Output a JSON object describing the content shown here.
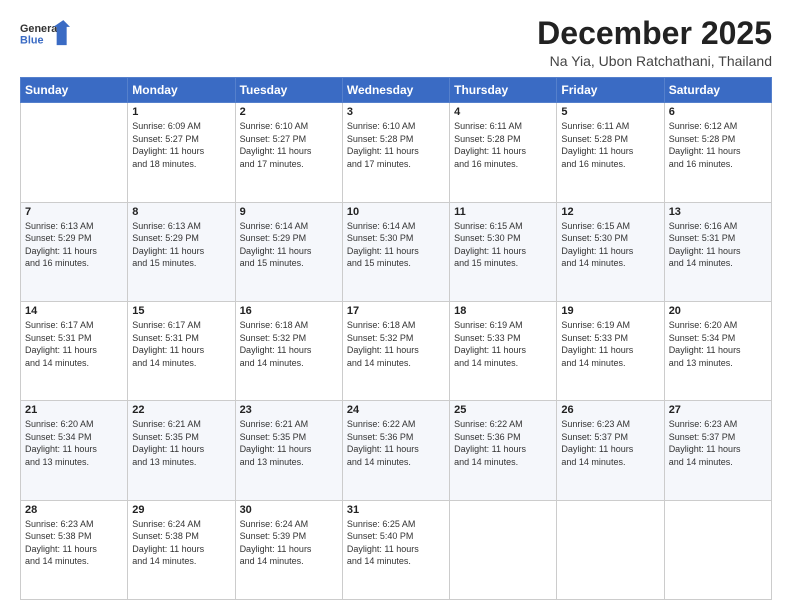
{
  "logo": {
    "line1": "General",
    "line2": "Blue"
  },
  "title": "December 2025",
  "location": "Na Yia, Ubon Ratchathani, Thailand",
  "days_of_week": [
    "Sunday",
    "Monday",
    "Tuesday",
    "Wednesday",
    "Thursday",
    "Friday",
    "Saturday"
  ],
  "weeks": [
    [
      {
        "day": "",
        "info": ""
      },
      {
        "day": "1",
        "info": "Sunrise: 6:09 AM\nSunset: 5:27 PM\nDaylight: 11 hours\nand 18 minutes."
      },
      {
        "day": "2",
        "info": "Sunrise: 6:10 AM\nSunset: 5:27 PM\nDaylight: 11 hours\nand 17 minutes."
      },
      {
        "day": "3",
        "info": "Sunrise: 6:10 AM\nSunset: 5:28 PM\nDaylight: 11 hours\nand 17 minutes."
      },
      {
        "day": "4",
        "info": "Sunrise: 6:11 AM\nSunset: 5:28 PM\nDaylight: 11 hours\nand 16 minutes."
      },
      {
        "day": "5",
        "info": "Sunrise: 6:11 AM\nSunset: 5:28 PM\nDaylight: 11 hours\nand 16 minutes."
      },
      {
        "day": "6",
        "info": "Sunrise: 6:12 AM\nSunset: 5:28 PM\nDaylight: 11 hours\nand 16 minutes."
      }
    ],
    [
      {
        "day": "7",
        "info": "Sunrise: 6:13 AM\nSunset: 5:29 PM\nDaylight: 11 hours\nand 16 minutes."
      },
      {
        "day": "8",
        "info": "Sunrise: 6:13 AM\nSunset: 5:29 PM\nDaylight: 11 hours\nand 15 minutes."
      },
      {
        "day": "9",
        "info": "Sunrise: 6:14 AM\nSunset: 5:29 PM\nDaylight: 11 hours\nand 15 minutes."
      },
      {
        "day": "10",
        "info": "Sunrise: 6:14 AM\nSunset: 5:30 PM\nDaylight: 11 hours\nand 15 minutes."
      },
      {
        "day": "11",
        "info": "Sunrise: 6:15 AM\nSunset: 5:30 PM\nDaylight: 11 hours\nand 15 minutes."
      },
      {
        "day": "12",
        "info": "Sunrise: 6:15 AM\nSunset: 5:30 PM\nDaylight: 11 hours\nand 14 minutes."
      },
      {
        "day": "13",
        "info": "Sunrise: 6:16 AM\nSunset: 5:31 PM\nDaylight: 11 hours\nand 14 minutes."
      }
    ],
    [
      {
        "day": "14",
        "info": "Sunrise: 6:17 AM\nSunset: 5:31 PM\nDaylight: 11 hours\nand 14 minutes."
      },
      {
        "day": "15",
        "info": "Sunrise: 6:17 AM\nSunset: 5:31 PM\nDaylight: 11 hours\nand 14 minutes."
      },
      {
        "day": "16",
        "info": "Sunrise: 6:18 AM\nSunset: 5:32 PM\nDaylight: 11 hours\nand 14 minutes."
      },
      {
        "day": "17",
        "info": "Sunrise: 6:18 AM\nSunset: 5:32 PM\nDaylight: 11 hours\nand 14 minutes."
      },
      {
        "day": "18",
        "info": "Sunrise: 6:19 AM\nSunset: 5:33 PM\nDaylight: 11 hours\nand 14 minutes."
      },
      {
        "day": "19",
        "info": "Sunrise: 6:19 AM\nSunset: 5:33 PM\nDaylight: 11 hours\nand 14 minutes."
      },
      {
        "day": "20",
        "info": "Sunrise: 6:20 AM\nSunset: 5:34 PM\nDaylight: 11 hours\nand 13 minutes."
      }
    ],
    [
      {
        "day": "21",
        "info": "Sunrise: 6:20 AM\nSunset: 5:34 PM\nDaylight: 11 hours\nand 13 minutes."
      },
      {
        "day": "22",
        "info": "Sunrise: 6:21 AM\nSunset: 5:35 PM\nDaylight: 11 hours\nand 13 minutes."
      },
      {
        "day": "23",
        "info": "Sunrise: 6:21 AM\nSunset: 5:35 PM\nDaylight: 11 hours\nand 13 minutes."
      },
      {
        "day": "24",
        "info": "Sunrise: 6:22 AM\nSunset: 5:36 PM\nDaylight: 11 hours\nand 14 minutes."
      },
      {
        "day": "25",
        "info": "Sunrise: 6:22 AM\nSunset: 5:36 PM\nDaylight: 11 hours\nand 14 minutes."
      },
      {
        "day": "26",
        "info": "Sunrise: 6:23 AM\nSunset: 5:37 PM\nDaylight: 11 hours\nand 14 minutes."
      },
      {
        "day": "27",
        "info": "Sunrise: 6:23 AM\nSunset: 5:37 PM\nDaylight: 11 hours\nand 14 minutes."
      }
    ],
    [
      {
        "day": "28",
        "info": "Sunrise: 6:23 AM\nSunset: 5:38 PM\nDaylight: 11 hours\nand 14 minutes."
      },
      {
        "day": "29",
        "info": "Sunrise: 6:24 AM\nSunset: 5:38 PM\nDaylight: 11 hours\nand 14 minutes."
      },
      {
        "day": "30",
        "info": "Sunrise: 6:24 AM\nSunset: 5:39 PM\nDaylight: 11 hours\nand 14 minutes."
      },
      {
        "day": "31",
        "info": "Sunrise: 6:25 AM\nSunset: 5:40 PM\nDaylight: 11 hours\nand 14 minutes."
      },
      {
        "day": "",
        "info": ""
      },
      {
        "day": "",
        "info": ""
      },
      {
        "day": "",
        "info": ""
      }
    ]
  ]
}
